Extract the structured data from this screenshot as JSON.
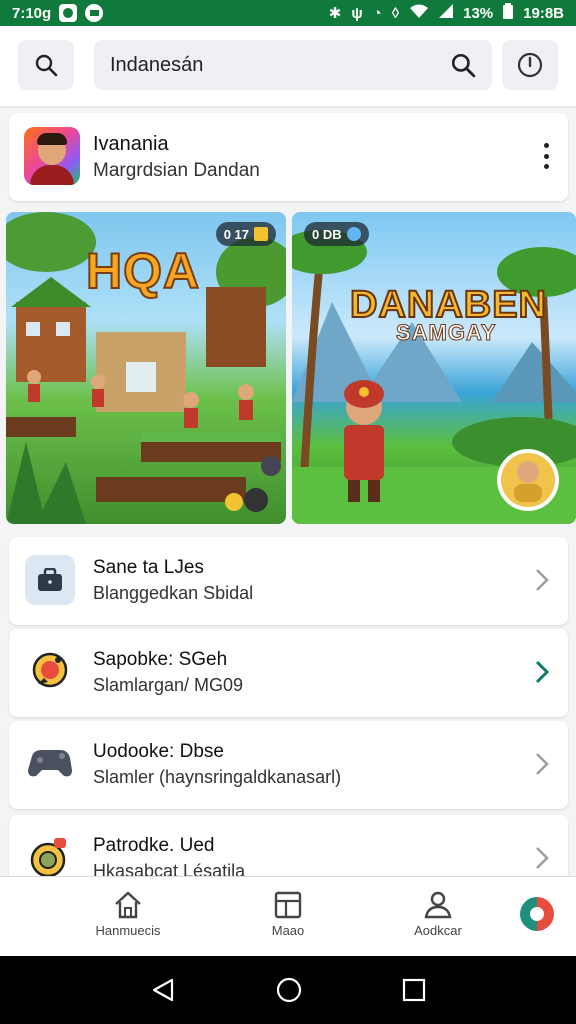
{
  "status_bar": {
    "time": "7:10g",
    "battery_percent": "13%",
    "clock_right": "19:8B"
  },
  "search": {
    "value": "Indanesán"
  },
  "profile": {
    "name": "Ivanania",
    "subtitle": "Margrdsian Dandan"
  },
  "banners": [
    {
      "badge": "0 17",
      "title": "HQA"
    },
    {
      "badge": "0 DB",
      "title": "DANABEN",
      "subtitle": "SAMGAY"
    }
  ],
  "list": [
    {
      "title": "Sane ta LJes",
      "subtitle": "Blanggedkan Sbidal",
      "icon": "briefcase-icon"
    },
    {
      "title": "Sapobke: SGeh",
      "subtitle": "Slamlargan/ MG09",
      "icon": "compass-icon"
    },
    {
      "title": "Uodooke: Dbse",
      "subtitle": "Slamler (haynsringaldkanasarl)",
      "icon": "controller-icon"
    },
    {
      "title": "Patrodke. Ued",
      "subtitle": "Hkasabcat Lésatila",
      "icon": "target-icon"
    }
  ],
  "bottom_nav": [
    {
      "label": "Hanmuecis",
      "icon": "home-icon"
    },
    {
      "label": "Maao",
      "icon": "layout-icon"
    },
    {
      "label": "Aodkcar",
      "icon": "person-icon"
    }
  ],
  "colors": {
    "status_bar": "#0f7a3c",
    "accent": "#0f7a6c"
  }
}
